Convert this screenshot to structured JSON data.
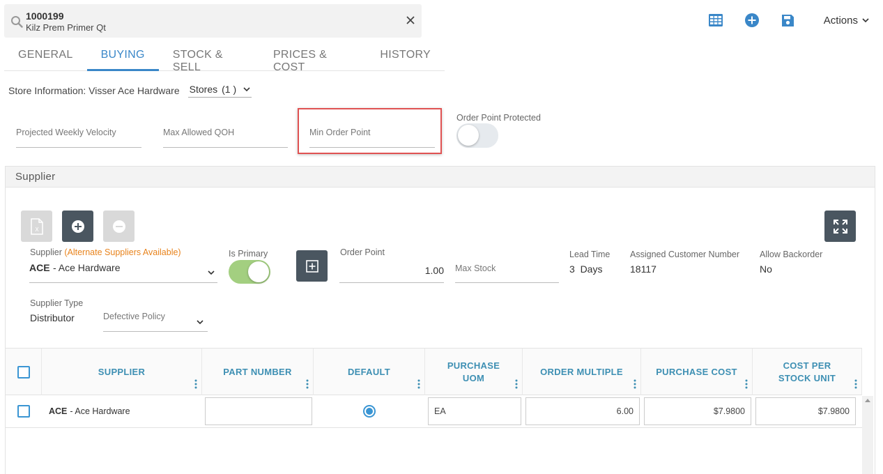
{
  "search": {
    "item_id": "1000199",
    "item_desc": "Kilz Prem Primer Qt"
  },
  "toolbar": {
    "actions_label": "Actions",
    "accent": "#3a87c8"
  },
  "tabs": [
    {
      "label": "GENERAL",
      "active": false
    },
    {
      "label": "BUYING",
      "active": true
    },
    {
      "label": "STOCK & SELL",
      "active": false
    },
    {
      "label": "PRICES & COST",
      "active": false
    },
    {
      "label": "HISTORY",
      "active": false
    }
  ],
  "store_info": {
    "label": "Store Information: Visser Ace Hardware",
    "stores_value": "Stores",
    "stores_count": "(1 )"
  },
  "store_fields": {
    "projected_weekly_velocity": "Projected Weekly Velocity",
    "max_allowed_qoh": "Max Allowed QOH",
    "min_order_point": "Min Order Point",
    "order_point_protected_label": "Order Point Protected",
    "order_point_protected_on": false
  },
  "supplier": {
    "section_title": "Supplier",
    "supplier_label": "Supplier",
    "alternate_note": "(Alternate Suppliers Available)",
    "supplier_code": "ACE",
    "supplier_name": "- Ace Hardware",
    "is_primary_label": "Is Primary",
    "is_primary_on": true,
    "order_point_label": "Order Point",
    "order_point_value": "1.00",
    "max_stock_placeholder": "Max Stock",
    "lead_time_label": "Lead Time",
    "lead_time_value": "3  Days",
    "customer_number_label": "Assigned Customer Number",
    "customer_number_value": "18117",
    "backorder_label": "Allow Backorder",
    "backorder_value": "No",
    "supplier_type_label": "Supplier Type",
    "supplier_type_value": "Distributor",
    "defective_policy_placeholder": "Defective Policy"
  },
  "grid": {
    "columns": [
      "SUPPLIER",
      "PART NUMBER",
      "DEFAULT",
      "PURCHASE UOM",
      "ORDER MULTIPLE",
      "PURCHASE COST",
      "COST PER STOCK UNIT"
    ],
    "rows": [
      {
        "supplier_code": "ACE",
        "supplier_name": "- Ace Hardware",
        "part_number": "",
        "default": true,
        "purchase_uom": "EA",
        "order_multiple": "6.00",
        "purchase_cost": "$7.9800",
        "cost_per_stock_unit": "$7.9800"
      }
    ]
  }
}
